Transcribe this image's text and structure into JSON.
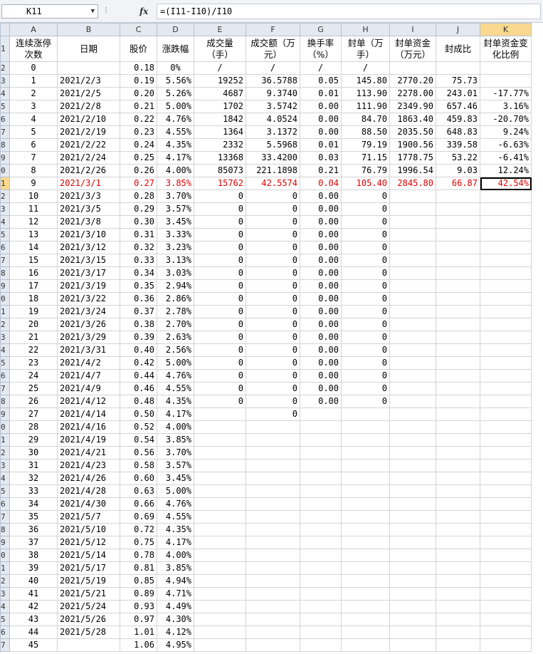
{
  "formula_bar": {
    "cell_ref": "K11",
    "fx_label": "fx",
    "formula": "=(I11-I10)/I10"
  },
  "colors": {
    "red_text": "#e00000",
    "header_bg": "#e4e9f1",
    "selected_header": "#f8d98f"
  },
  "columns": [
    "A",
    "B",
    "C",
    "D",
    "E",
    "F",
    "G",
    "H",
    "I",
    "J",
    "K"
  ],
  "header_row": {
    "row_label": "1",
    "cells": [
      "连续涨停次数",
      "日期",
      "股价",
      "涨跌幅",
      "成交量（手）",
      "成交额（万元）",
      "换手率（%）",
      "封单（万手）",
      "封单资金（万元）",
      "封成比",
      "封单资金变化比例"
    ]
  },
  "rows": [
    {
      "rh": "2",
      "c": [
        "0",
        "",
        "0.18",
        "0%",
        "/",
        "/",
        "/",
        "/",
        "",
        "",
        ""
      ]
    },
    {
      "rh": "3",
      "c": [
        "1",
        "2021/2/3",
        "0.19",
        "5.56%",
        "19252",
        "36.5788",
        "0.05",
        "145.80",
        "2770.20",
        "75.73",
        ""
      ]
    },
    {
      "rh": "4",
      "c": [
        "2",
        "2021/2/5",
        "0.20",
        "5.26%",
        "4687",
        "9.3740",
        "0.01",
        "113.90",
        "2278.00",
        "243.01",
        "-17.77%"
      ]
    },
    {
      "rh": "5",
      "c": [
        "3",
        "2021/2/8",
        "0.21",
        "5.00%",
        "1702",
        "3.5742",
        "0.00",
        "111.90",
        "2349.90",
        "657.46",
        "3.16%"
      ]
    },
    {
      "rh": "6",
      "c": [
        "4",
        "2021/2/10",
        "0.22",
        "4.76%",
        "1842",
        "4.0524",
        "0.00",
        "84.70",
        "1863.40",
        "459.83",
        "-20.70%"
      ]
    },
    {
      "rh": "7",
      "c": [
        "5",
        "2021/2/19",
        "0.23",
        "4.55%",
        "1364",
        "3.1372",
        "0.00",
        "88.50",
        "2035.50",
        "648.83",
        "9.24%"
      ]
    },
    {
      "rh": "8",
      "c": [
        "6",
        "2021/2/22",
        "0.24",
        "4.35%",
        "2332",
        "5.5968",
        "0.01",
        "79.19",
        "1900.56",
        "339.58",
        "-6.63%"
      ]
    },
    {
      "rh": "9",
      "c": [
        "7",
        "2021/2/24",
        "0.25",
        "4.17%",
        "13368",
        "33.4200",
        "0.03",
        "71.15",
        "1778.75",
        "53.22",
        "-6.41%"
      ]
    },
    {
      "rh": "0",
      "c": [
        "8",
        "2021/2/26",
        "0.26",
        "4.00%",
        "85073",
        "221.1898",
        "0.21",
        "76.79",
        "1996.54",
        "9.03",
        "12.24%"
      ]
    },
    {
      "rh": "1",
      "c": [
        "9",
        "2021/3/1",
        "0.27",
        "3.85%",
        "15762",
        "42.5574",
        "0.04",
        "105.40",
        "2845.80",
        "66.87",
        "42.54%"
      ],
      "red": true
    },
    {
      "rh": "2",
      "c": [
        "10",
        "2021/3/3",
        "0.28",
        "3.70%",
        "0",
        "0",
        "0.00",
        "0",
        "",
        "",
        ""
      ]
    },
    {
      "rh": "3",
      "c": [
        "11",
        "2021/3/5",
        "0.29",
        "3.57%",
        "0",
        "0",
        "0.00",
        "0",
        "",
        "",
        ""
      ]
    },
    {
      "rh": "4",
      "c": [
        "12",
        "2021/3/8",
        "0.30",
        "3.45%",
        "0",
        "0",
        "0.00",
        "0",
        "",
        "",
        ""
      ]
    },
    {
      "rh": "5",
      "c": [
        "13",
        "2021/3/10",
        "0.31",
        "3.33%",
        "0",
        "0",
        "0.00",
        "0",
        "",
        "",
        ""
      ]
    },
    {
      "rh": "6",
      "c": [
        "14",
        "2021/3/12",
        "0.32",
        "3.23%",
        "0",
        "0",
        "0.00",
        "0",
        "",
        "",
        ""
      ]
    },
    {
      "rh": "7",
      "c": [
        "15",
        "2021/3/15",
        "0.33",
        "3.13%",
        "0",
        "0",
        "0.00",
        "0",
        "",
        "",
        ""
      ]
    },
    {
      "rh": "8",
      "c": [
        "16",
        "2021/3/17",
        "0.34",
        "3.03%",
        "0",
        "0",
        "0.00",
        "0",
        "",
        "",
        ""
      ]
    },
    {
      "rh": "9",
      "c": [
        "17",
        "2021/3/19",
        "0.35",
        "2.94%",
        "0",
        "0",
        "0.00",
        "0",
        "",
        "",
        ""
      ]
    },
    {
      "rh": "0",
      "c": [
        "18",
        "2021/3/22",
        "0.36",
        "2.86%",
        "0",
        "0",
        "0.00",
        "0",
        "",
        "",
        ""
      ]
    },
    {
      "rh": "1",
      "c": [
        "19",
        "2021/3/24",
        "0.37",
        "2.78%",
        "0",
        "0",
        "0.00",
        "0",
        "",
        "",
        ""
      ]
    },
    {
      "rh": "2",
      "c": [
        "20",
        "2021/3/26",
        "0.38",
        "2.70%",
        "0",
        "0",
        "0.00",
        "0",
        "",
        "",
        ""
      ]
    },
    {
      "rh": "3",
      "c": [
        "21",
        "2021/3/29",
        "0.39",
        "2.63%",
        "0",
        "0",
        "0.00",
        "0",
        "",
        "",
        ""
      ]
    },
    {
      "rh": "4",
      "c": [
        "22",
        "2021/3/31",
        "0.40",
        "2.56%",
        "0",
        "0",
        "0.00",
        "0",
        "",
        "",
        ""
      ]
    },
    {
      "rh": "5",
      "c": [
        "23",
        "2021/4/2",
        "0.42",
        "5.00%",
        "0",
        "0",
        "0.00",
        "0",
        "",
        "",
        ""
      ]
    },
    {
      "rh": "6",
      "c": [
        "24",
        "2021/4/7",
        "0.44",
        "4.76%",
        "0",
        "0",
        "0.00",
        "0",
        "",
        "",
        ""
      ]
    },
    {
      "rh": "7",
      "c": [
        "25",
        "2021/4/9",
        "0.46",
        "4.55%",
        "0",
        "0",
        "0.00",
        "0",
        "",
        "",
        ""
      ]
    },
    {
      "rh": "8",
      "c": [
        "26",
        "2021/4/12",
        "0.48",
        "4.35%",
        "0",
        "0",
        "0.00",
        "0",
        "",
        "",
        ""
      ]
    },
    {
      "rh": "9",
      "c": [
        "27",
        "2021/4/14",
        "0.50",
        "4.17%",
        "",
        "0",
        "",
        "",
        "",
        "",
        ""
      ]
    },
    {
      "rh": "0",
      "c": [
        "28",
        "2021/4/16",
        "0.52",
        "4.00%",
        "",
        "",
        "",
        "",
        "",
        "",
        ""
      ]
    },
    {
      "rh": "1",
      "c": [
        "29",
        "2021/4/19",
        "0.54",
        "3.85%",
        "",
        "",
        "",
        "",
        "",
        "",
        ""
      ]
    },
    {
      "rh": "2",
      "c": [
        "30",
        "2021/4/21",
        "0.56",
        "3.70%",
        "",
        "",
        "",
        "",
        "",
        "",
        ""
      ]
    },
    {
      "rh": "3",
      "c": [
        "31",
        "2021/4/23",
        "0.58",
        "3.57%",
        "",
        "",
        "",
        "",
        "",
        "",
        ""
      ]
    },
    {
      "rh": "4",
      "c": [
        "32",
        "2021/4/26",
        "0.60",
        "3.45%",
        "",
        "",
        "",
        "",
        "",
        "",
        ""
      ]
    },
    {
      "rh": "5",
      "c": [
        "33",
        "2021/4/28",
        "0.63",
        "5.00%",
        "",
        "",
        "",
        "",
        "",
        "",
        ""
      ]
    },
    {
      "rh": "6",
      "c": [
        "34",
        "2021/4/30",
        "0.66",
        "4.76%",
        "",
        "",
        "",
        "",
        "",
        "",
        ""
      ]
    },
    {
      "rh": "7",
      "c": [
        "35",
        "2021/5/7",
        "0.69",
        "4.55%",
        "",
        "",
        "",
        "",
        "",
        "",
        ""
      ]
    },
    {
      "rh": "8",
      "c": [
        "36",
        "2021/5/10",
        "0.72",
        "4.35%",
        "",
        "",
        "",
        "",
        "",
        "",
        ""
      ]
    },
    {
      "rh": "9",
      "c": [
        "37",
        "2021/5/12",
        "0.75",
        "4.17%",
        "",
        "",
        "",
        "",
        "",
        "",
        ""
      ]
    },
    {
      "rh": "0",
      "c": [
        "38",
        "2021/5/14",
        "0.78",
        "4.00%",
        "",
        "",
        "",
        "",
        "",
        "",
        ""
      ]
    },
    {
      "rh": "1",
      "c": [
        "39",
        "2021/5/17",
        "0.81",
        "3.85%",
        "",
        "",
        "",
        "",
        "",
        "",
        ""
      ]
    },
    {
      "rh": "2",
      "c": [
        "40",
        "2021/5/19",
        "0.85",
        "4.94%",
        "",
        "",
        "",
        "",
        "",
        "",
        ""
      ]
    },
    {
      "rh": "3",
      "c": [
        "41",
        "2021/5/21",
        "0.89",
        "4.71%",
        "",
        "",
        "",
        "",
        "",
        "",
        ""
      ]
    },
    {
      "rh": "4",
      "c": [
        "42",
        "2021/5/24",
        "0.93",
        "4.49%",
        "",
        "",
        "",
        "",
        "",
        "",
        ""
      ]
    },
    {
      "rh": "5",
      "c": [
        "43",
        "2021/5/26",
        "0.97",
        "4.30%",
        "",
        "",
        "",
        "",
        "",
        "",
        ""
      ]
    },
    {
      "rh": "6",
      "c": [
        "44",
        "2021/5/28",
        "1.01",
        "4.12%",
        "",
        "",
        "",
        "",
        "",
        "",
        ""
      ]
    },
    {
      "rh": "7",
      "c": [
        "45",
        "",
        "1.06",
        "4.95%",
        "",
        "",
        "",
        "",
        "",
        "",
        ""
      ]
    }
  ]
}
